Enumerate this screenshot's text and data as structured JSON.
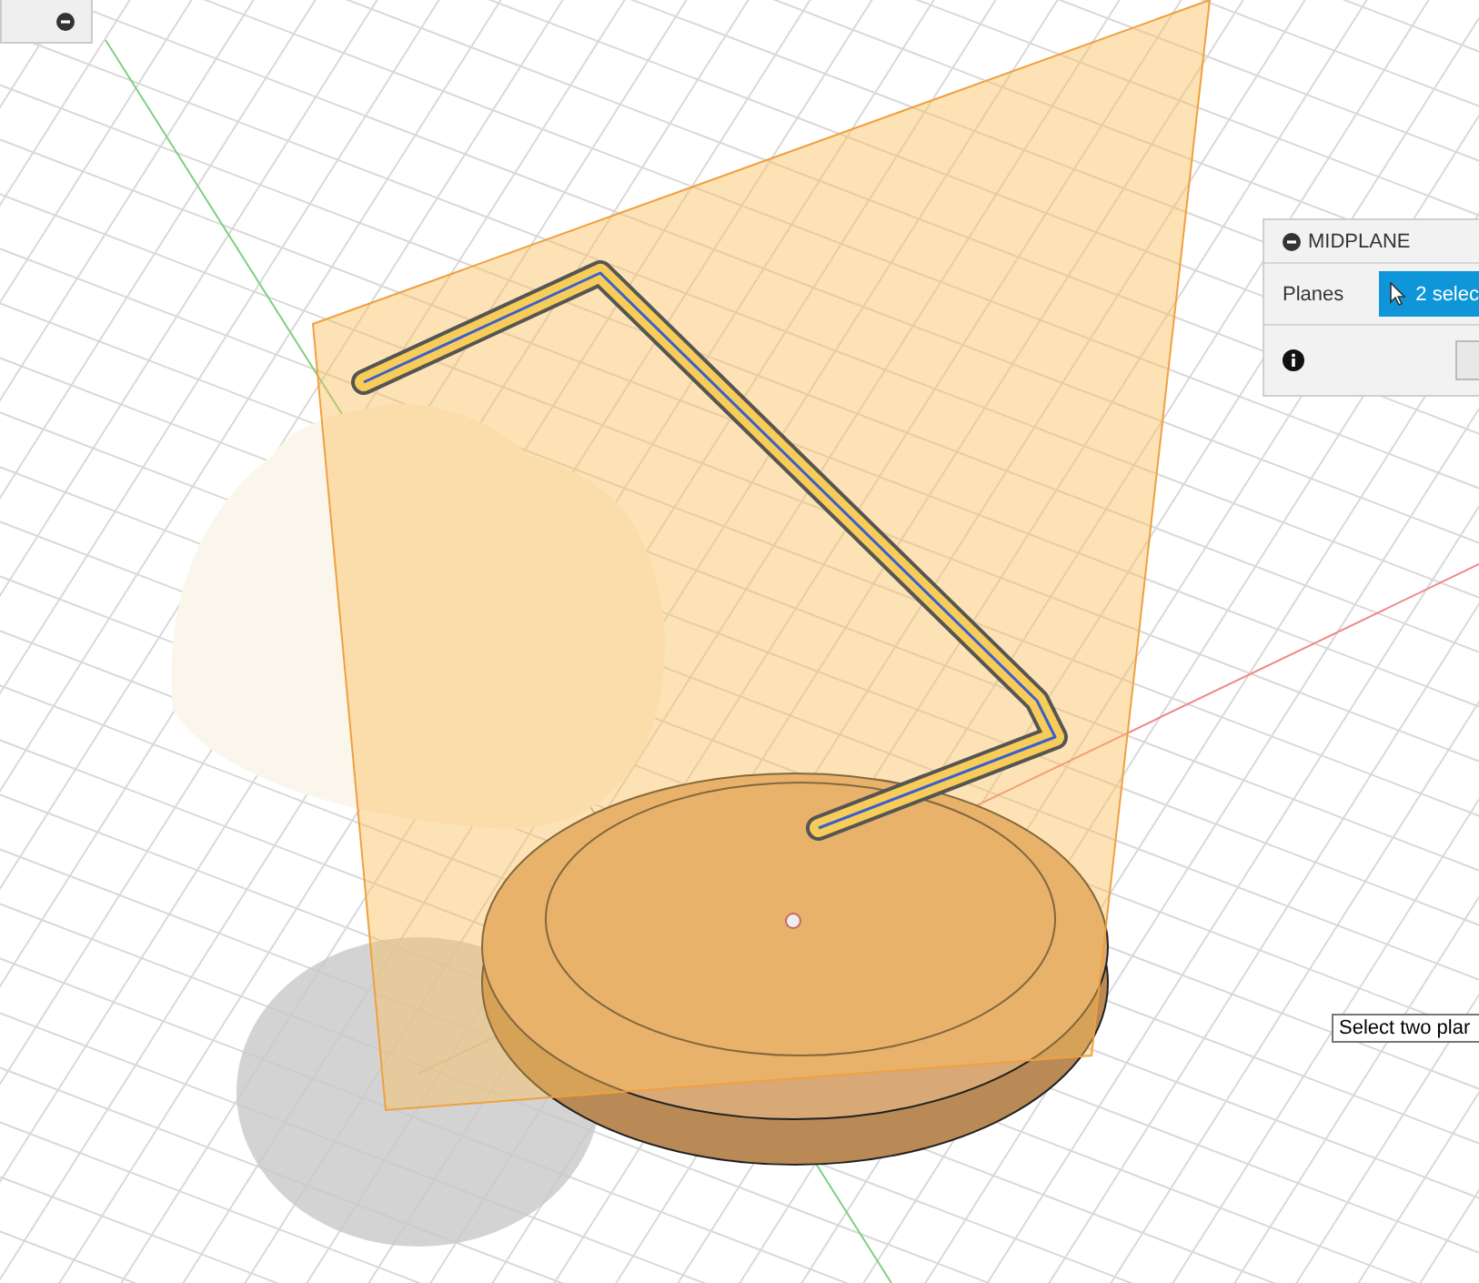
{
  "midplane_dialog": {
    "title": "MIDPLANE",
    "planes": {
      "label": "Planes",
      "selection": "2 selec",
      "selected": true
    }
  },
  "tooltip": {
    "text": "Select two plar"
  }
}
